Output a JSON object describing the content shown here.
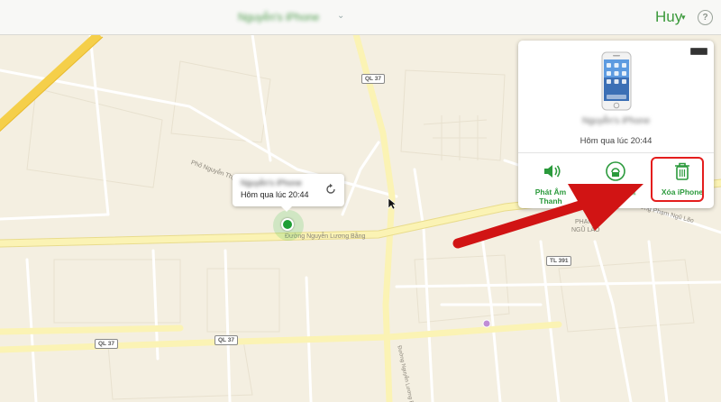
{
  "header": {
    "device_name": "Nguyễn's iPhone",
    "user_name": "Huy",
    "help_symbol": "?"
  },
  "map": {
    "location_callout": {
      "device_name": "Nguyễn's iPhone",
      "last_seen": "Hôm qua lúc 20:44"
    },
    "street_labels": {
      "pho_nguyen_thi_due": "Phố Nguyễn Thị Duệ",
      "duong_nguyen_luong_bang": "Đường Nguyễn Lương Bằng",
      "duong_pham_ngu_lao": "Đường Phạm Ngũ Lão",
      "pham_ngu_lao_area_line1": "PHẠM",
      "pham_ngu_lao_area_line2": "NGŨ LÃO",
      "duong_vertical": "Đường Nguyễn Lương Bằng"
    },
    "route_shields": {
      "ql37_top": "QL 37",
      "ql37_bottom_left": "QL 37",
      "ql37_bottom_mid": "QL 37",
      "tl391": "TL 391"
    },
    "colors": {
      "land": "#f4efe1",
      "major_road": "#fbf3b4",
      "highway": "#f5cf4a",
      "minor_road": "#ffffff",
      "pin": "#1e9e34"
    }
  },
  "device_panel": {
    "device_name": "Nguyễn's iPhone",
    "last_seen": "Hôm qua lúc 20:44",
    "actions": {
      "play_sound": {
        "line1": "Phát Âm",
        "line2": "Thanh"
      },
      "lost_mode": {
        "line1": "Mất"
      },
      "erase": {
        "line1": "Xóa iPhone"
      }
    },
    "accent_color": "#2b9a3c"
  },
  "annotation": {
    "highlight_color": "#e41d1d"
  }
}
